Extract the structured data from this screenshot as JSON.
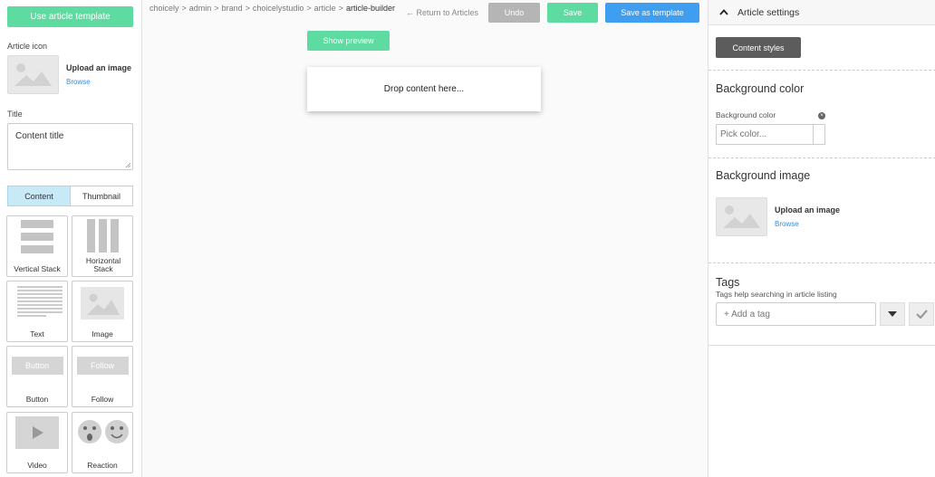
{
  "sidebar": {
    "use_template_label": "Use article template",
    "article_icon_label": "Article icon",
    "upload_label": "Upload an image",
    "browse_label": "Browse",
    "title_label": "Title",
    "title_value": "Content title",
    "tabs": [
      "Content",
      "Thumbnail"
    ],
    "tiles": [
      {
        "label": "Vertical Stack",
        "icon": "vertical-stack-icon"
      },
      {
        "label": "Horizontal Stack",
        "icon": "horizontal-stack-icon"
      },
      {
        "label": "Text",
        "icon": "text-lines-icon"
      },
      {
        "label": "Image",
        "icon": "image-icon"
      },
      {
        "label": "Button",
        "icon": "button-icon",
        "preview": "Button"
      },
      {
        "label": "Follow",
        "icon": "follow-icon",
        "preview": "Follow"
      },
      {
        "label": "Video",
        "icon": "play-icon"
      },
      {
        "label": "Reaction",
        "icon": "reaction-faces-icon"
      }
    ]
  },
  "breadcrumb": [
    "choicely",
    "admin",
    "brand",
    "choicelystudio",
    "article",
    "article-builder"
  ],
  "toolbar": {
    "return_label": "Return to Articles",
    "undo_label": "Undo",
    "save_label": "Save",
    "save_template_label": "Save as template"
  },
  "canvas": {
    "preview_label": "Show preview",
    "drop_label": "Drop content here..."
  },
  "settings": {
    "header": "Article settings",
    "content_styles_label": "Content styles",
    "bg_color_heading": "Background color",
    "bg_color_label": "Background color",
    "color_placeholder": "Pick color...",
    "bg_image_heading": "Background image",
    "upload_label": "Upload an image",
    "browse_label": "Browse",
    "tags_heading": "Tags",
    "tags_help": "Tags help searching in article listing",
    "tag_placeholder": "+ Add a tag"
  },
  "colors": {
    "green": "#5ddba0",
    "blue": "#3f9ef0",
    "gray": "#b5b5b5",
    "dark": "#5c5c5c",
    "link": "#3a8bdc"
  }
}
